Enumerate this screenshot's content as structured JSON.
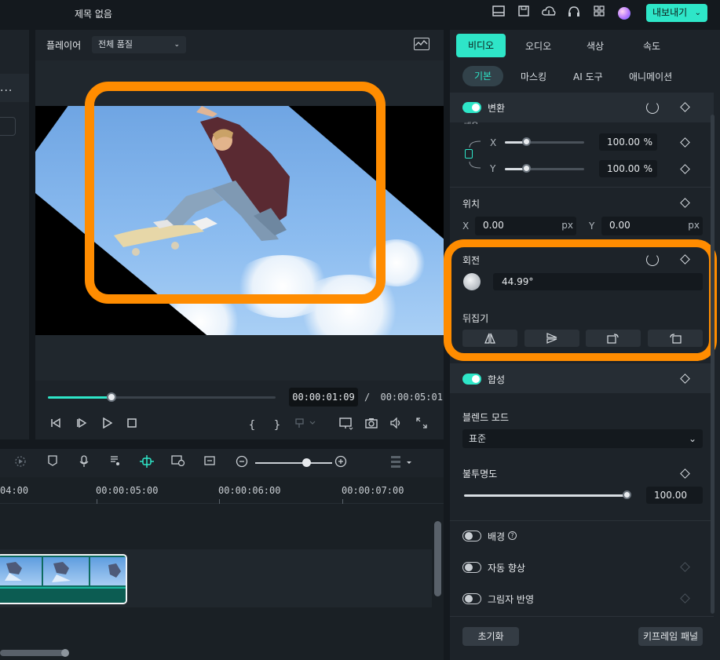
{
  "app": {
    "title": "제목 없음",
    "export_label": "내보내기",
    "export_chevron": "⌄",
    "accent": "#2ee6c8",
    "highlight": "#ff8c00"
  },
  "left_panel": {
    "dots": "..."
  },
  "player": {
    "label": "플레이어",
    "quality": "전체 품질",
    "current_time": "00:00:01:09",
    "separator": "/",
    "total_time": "00:00:05:01",
    "progress": 0.28
  },
  "controls": {
    "mark_in": "{",
    "mark_out": "}"
  },
  "timeline": {
    "ruler": [
      "04:00",
      "00:00:05:00",
      "00:00:06:00",
      "00:00:07:00"
    ]
  },
  "props": {
    "tabs": [
      "비디오",
      "오디오",
      "색상",
      "속도"
    ],
    "active_tab": "비디오",
    "subtabs": [
      "기본",
      "마스킹",
      "AI 도구",
      "애니메이션"
    ],
    "active_subtab": "기본",
    "transform": {
      "title": "변환",
      "enabled": true,
      "scale_label_partial": "배율",
      "x_label": "X",
      "y_label": "Y",
      "scale_x": "100.00",
      "scale_y": "100.00",
      "unit_pct": "%",
      "position_label": "위치",
      "pos_x_label": "X",
      "pos_x": "0.00",
      "pos_y_label": "Y",
      "pos_y": "0.00",
      "unit_px": "px"
    },
    "rotation": {
      "title": "회전",
      "value": "44.99°"
    },
    "flip": {
      "title": "뒤집기"
    },
    "compositing": {
      "title": "합성",
      "enabled": true,
      "blend_label": "블렌드 모드",
      "blend_value": "표준",
      "opacity_label": "불투명도",
      "opacity_value": "100.00"
    },
    "background": {
      "title": "배경",
      "enabled": false,
      "help": "?"
    },
    "auto_enhance": {
      "title": "자동 향상",
      "enabled": false
    },
    "shadow": {
      "title": "그림자 반영",
      "enabled": false
    },
    "reset_label": "초기화",
    "keyframe_panel_label": "키프레임 패널"
  }
}
